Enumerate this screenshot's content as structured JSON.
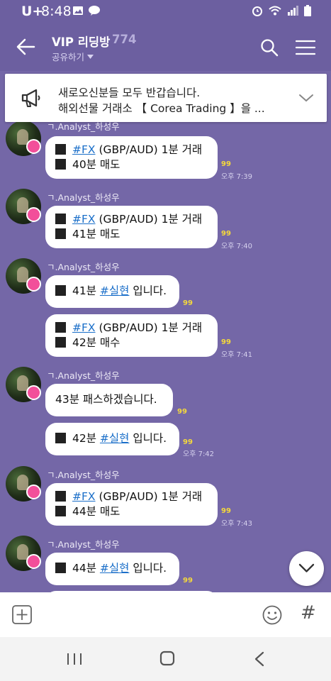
{
  "status_bar": {
    "carrier": "U+",
    "time": "8:48"
  },
  "header": {
    "title": "VIP 리딩방",
    "member_count": "774",
    "share_label": "공유하기"
  },
  "notice": {
    "line1": "새로오신분들 모두 반갑습니다.",
    "line2": "해외선물 거래소 【 Corea Trading 】을 ..."
  },
  "messages": [
    {
      "sender": "ㄱ.Analyst_하성우",
      "bubbles": [
        {
          "lines": [
            {
              "text": "",
              "tag": "#FX",
              "rest": " (GBP/AUD) 1분 거래"
            },
            {
              "text": "40분 매도"
            }
          ],
          "unread": "99",
          "time": "오후 7:39"
        }
      ]
    },
    {
      "sender": "ㄱ.Analyst_하성우",
      "bubbles": [
        {
          "lines": [
            {
              "text": "",
              "tag": "#FX",
              "rest": " (GBP/AUD) 1분 거래"
            },
            {
              "text": "41분 매도"
            }
          ],
          "unread": "99",
          "time": "오후 7:40"
        }
      ]
    },
    {
      "sender": "ㄱ.Analyst_하성우",
      "bubbles": [
        {
          "lines": [
            {
              "text": "41분 ",
              "tag": "#실현",
              "rest": " 입니다."
            }
          ],
          "unread": "99",
          "time": ""
        },
        {
          "lines": [
            {
              "text": "",
              "tag": "#FX",
              "rest": " (GBP/AUD) 1분 거래"
            },
            {
              "text": "42분 매수"
            }
          ],
          "unread": "99",
          "time": "오후 7:41"
        }
      ]
    },
    {
      "sender": "ㄱ.Analyst_하성우",
      "bubbles": [
        {
          "lines": [
            {
              "text": "43분 패스하겠습니다."
            }
          ],
          "unread": "99",
          "time": ""
        },
        {
          "lines": [
            {
              "text": "42분 ",
              "tag": "#실현",
              "rest": " 입니다."
            }
          ],
          "unread": "99",
          "time": "오후 7:42"
        }
      ]
    },
    {
      "sender": "ㄱ.Analyst_하성우",
      "bubbles": [
        {
          "lines": [
            {
              "text": "",
              "tag": "#FX",
              "rest": " (GBP/AUD) 1분 거래"
            },
            {
              "text": "44분 매도"
            }
          ],
          "unread": "99",
          "time": "오후 7:43"
        }
      ]
    },
    {
      "sender": "ㄱ.Analyst_하성우",
      "bubbles": [
        {
          "lines": [
            {
              "text": "44분 ",
              "tag": "#실현",
              "rest": " 입니다."
            }
          ],
          "unread": "99",
          "time": ""
        }
      ]
    }
  ],
  "input_bar": {
    "hash_label": "#"
  },
  "colors": {
    "chat_background": "#7467A7",
    "header_background": "#6C5FA0",
    "hashtag": "#1B6FC9",
    "unread": "#F4D83C",
    "crown_badge": "#F24F9A"
  },
  "icons": [
    "back-arrow-icon",
    "search-icon",
    "menu-icon",
    "megaphone-icon",
    "chevron-down-icon",
    "plus-icon",
    "emoji-icon",
    "hash-icon",
    "recent-apps-icon",
    "home-icon",
    "nav-back-icon"
  ]
}
